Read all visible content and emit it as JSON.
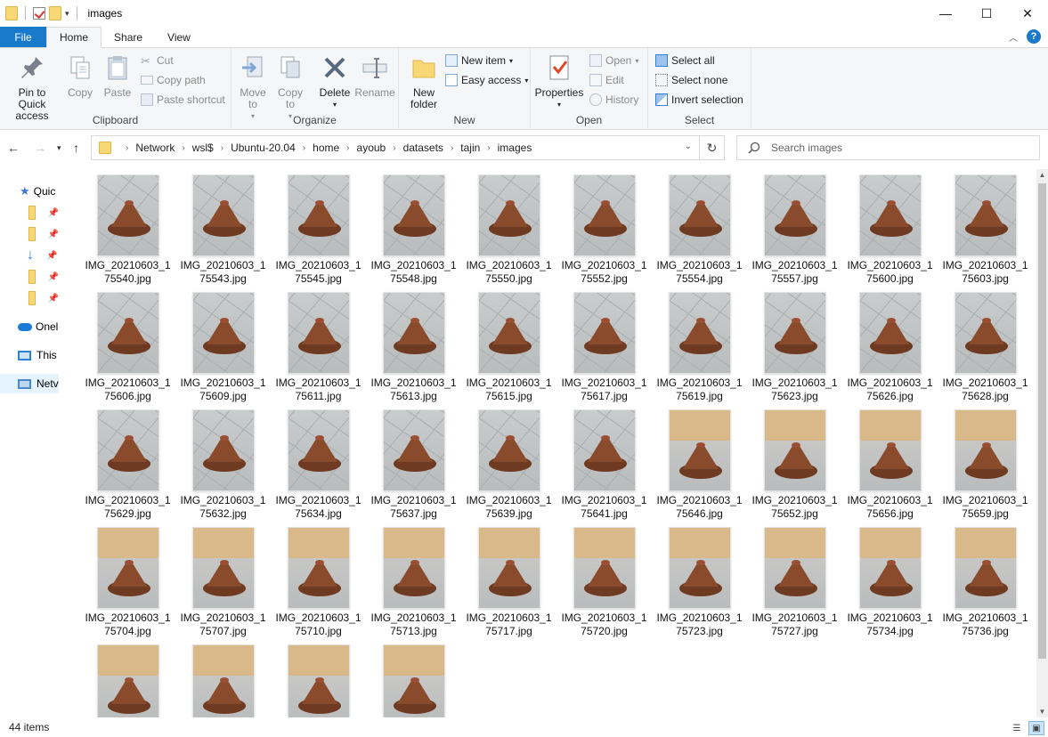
{
  "window": {
    "title": "images",
    "controls": {
      "minimize": "—",
      "maximize": "☐",
      "close": "✕"
    }
  },
  "ribbon_tabs": [
    "File",
    "Home",
    "Share",
    "View"
  ],
  "ribbon": {
    "clipboard": {
      "label": "Clipboard",
      "pin": "Pin to Quick access",
      "copy": "Copy",
      "paste": "Paste",
      "cut": "Cut",
      "copy_path": "Copy path",
      "paste_shortcut": "Paste shortcut"
    },
    "organize": {
      "label": "Organize",
      "move_to": "Move to",
      "copy_to": "Copy to",
      "delete": "Delete",
      "rename": "Rename"
    },
    "new": {
      "label": "New",
      "new_folder": "New folder",
      "new_item": "New item",
      "easy_access": "Easy access"
    },
    "open": {
      "label": "Open",
      "properties": "Properties",
      "open": "Open",
      "edit": "Edit",
      "history": "History"
    },
    "select": {
      "label": "Select",
      "select_all": "Select all",
      "select_none": "Select none",
      "invert_selection": "Invert selection"
    }
  },
  "address": {
    "crumbs": [
      "Network",
      "wsl$",
      "Ubuntu-20.04",
      "home",
      "ayoub",
      "datasets",
      "tajin",
      "images"
    ]
  },
  "search": {
    "placeholder": "Search images"
  },
  "nav_pane": {
    "quick_access": "Quic",
    "onedrive": "Onel",
    "this_pc": "This",
    "network": "Netv"
  },
  "files": [
    "IMG_20210603_175540.jpg",
    "IMG_20210603_175543.jpg",
    "IMG_20210603_175545.jpg",
    "IMG_20210603_175548.jpg",
    "IMG_20210603_175550.jpg",
    "IMG_20210603_175552.jpg",
    "IMG_20210603_175554.jpg",
    "IMG_20210603_175557.jpg",
    "IMG_20210603_175600.jpg",
    "IMG_20210603_175603.jpg",
    "IMG_20210603_175606.jpg",
    "IMG_20210603_175609.jpg",
    "IMG_20210603_175611.jpg",
    "IMG_20210603_175613.jpg",
    "IMG_20210603_175615.jpg",
    "IMG_20210603_175617.jpg",
    "IMG_20210603_175619.jpg",
    "IMG_20210603_175623.jpg",
    "IMG_20210603_175626.jpg",
    "IMG_20210603_175628.jpg",
    "IMG_20210603_175629.jpg",
    "IMG_20210603_175632.jpg",
    "IMG_20210603_175634.jpg",
    "IMG_20210603_175637.jpg",
    "IMG_20210603_175639.jpg",
    "IMG_20210603_175641.jpg",
    "IMG_20210603_175646.jpg",
    "IMG_20210603_175652.jpg",
    "IMG_20210603_175656.jpg",
    "IMG_20210603_175659.jpg",
    "IMG_20210603_175704.jpg",
    "IMG_20210603_175707.jpg",
    "IMG_20210603_175710.jpg",
    "IMG_20210603_175713.jpg",
    "IMG_20210603_175717.jpg",
    "IMG_20210603_175720.jpg",
    "IMG_20210603_175723.jpg",
    "IMG_20210603_175727.jpg",
    "IMG_20210603_175734.jpg",
    "IMG_20210603_175736.jpg",
    "",
    "",
    "",
    ""
  ],
  "status": {
    "item_count": "44 items"
  },
  "colors": {
    "accent": "#1979ca",
    "ribbon_bg": "#f5f6f7",
    "clay": "#8a4a2c",
    "tile_floor": "#b9bcbd",
    "wall": "#d9b98a"
  }
}
